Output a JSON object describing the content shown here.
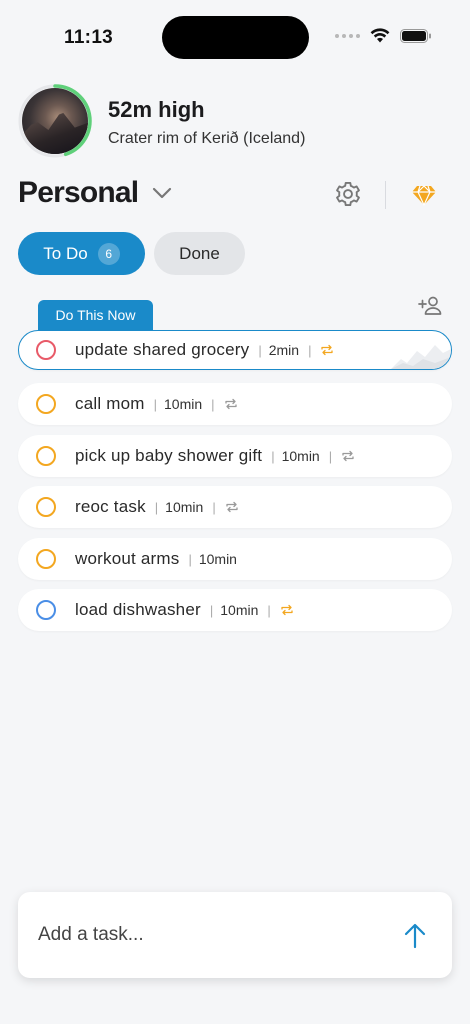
{
  "status_bar": {
    "time": "11:13"
  },
  "location": {
    "height_label": "52m high",
    "place": "Crater rim of Kerið (Iceland)",
    "progress": 0.45,
    "progress_color": "#5fd07a"
  },
  "list": {
    "title": "Personal"
  },
  "tabs": {
    "todo_label": "To Do",
    "todo_count": "6",
    "done_label": "Done",
    "active_color": "#1a8ac9"
  },
  "do_now_label": "Do This Now",
  "tasks": [
    {
      "name": "update shared grocery",
      "duration": "2min",
      "priority_color": "#e85a68",
      "repeat": true,
      "repeat_color": "#f3a720"
    },
    {
      "name": "call mom",
      "duration": "10min",
      "priority_color": "#f3a720",
      "repeat": true,
      "repeat_color": "#9a9a9a"
    },
    {
      "name": "pick up baby shower gift",
      "duration": "10min",
      "priority_color": "#f3a720",
      "repeat": true,
      "repeat_color": "#9a9a9a"
    },
    {
      "name": "reoc task",
      "duration": "10min",
      "priority_color": "#f3a720",
      "repeat": true,
      "repeat_color": "#9a9a9a"
    },
    {
      "name": "workout arms",
      "duration": "10min",
      "priority_color": "#f3a720",
      "repeat": false
    },
    {
      "name": "load dishwasher",
      "duration": "10min",
      "priority_color": "#4a8ee6",
      "repeat": true,
      "repeat_color": "#f3a720"
    }
  ],
  "composer": {
    "placeholder": "Add a task..."
  },
  "icons": {
    "gear": "gear-icon",
    "gem": "gem-icon",
    "chevron": "chevron-down-icon",
    "add_person": "add-person-icon",
    "repeat": "repeat-icon",
    "send": "arrow-up-icon"
  }
}
